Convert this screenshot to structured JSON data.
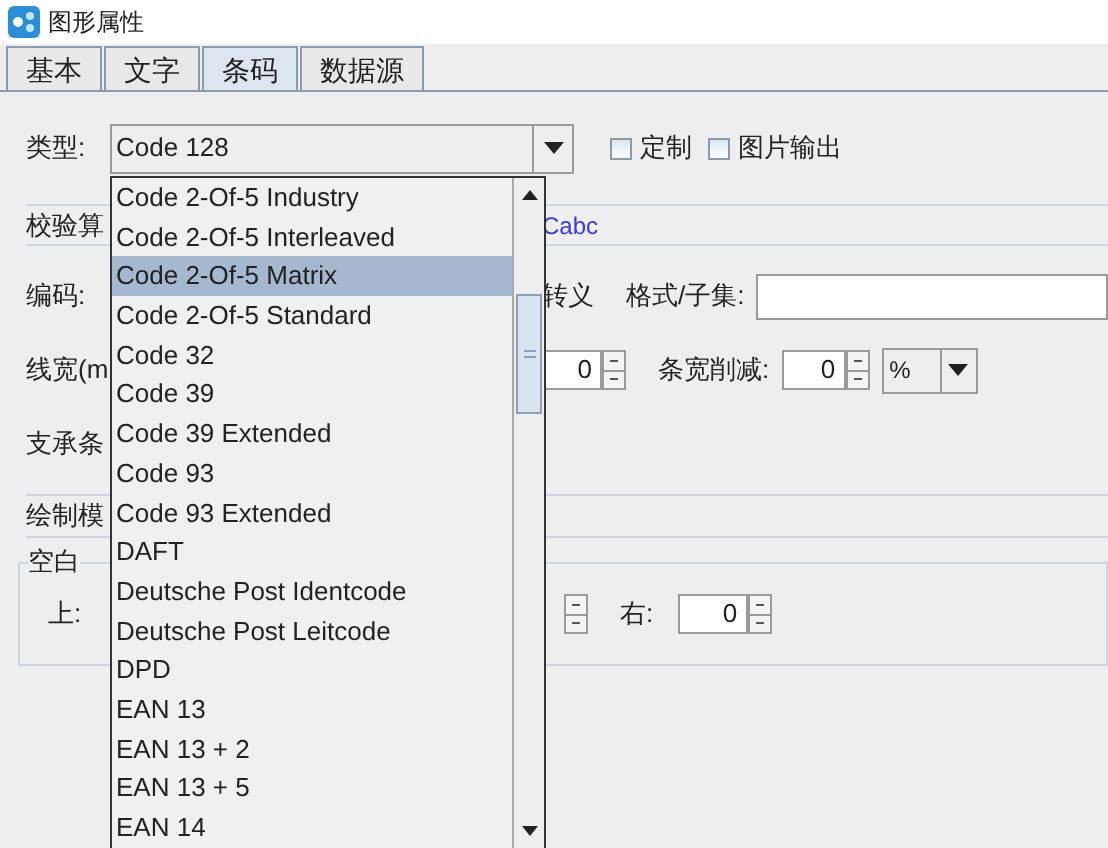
{
  "window": {
    "title": "图形属性"
  },
  "tabs": [
    {
      "label": "基本",
      "selected": false
    },
    {
      "label": "文字",
      "selected": false
    },
    {
      "label": "条码",
      "selected": true
    },
    {
      "label": "数据源",
      "selected": false
    }
  ],
  "type_row": {
    "label": "类型:",
    "value": "Code 128",
    "options": [
      {
        "label": "定制",
        "checked": false
      },
      {
        "label": "图片输出",
        "checked": false
      }
    ]
  },
  "checksum": {
    "label": "校验算",
    "value": "Cabc"
  },
  "encoding": {
    "label": "编码:",
    "escape_label": "转义",
    "format_label": "格式/子集:"
  },
  "line_width": {
    "label": "线宽(m",
    "value": "0",
    "reduction_label": "条宽削减:",
    "reduction_value": "0",
    "unit": "%"
  },
  "support_label": "支承条",
  "draw_mode_label": "绘制模",
  "quiet_zone": {
    "title": "空白",
    "top_label": "上:",
    "right_label": "右:",
    "right_value": "0"
  },
  "dropdown": {
    "items": [
      {
        "label": "Code 2-Of-5 Industry",
        "selected": false
      },
      {
        "label": "Code 2-Of-5 Interleaved",
        "selected": false
      },
      {
        "label": "Code 2-Of-5 Matrix",
        "selected": true
      },
      {
        "label": "Code 2-Of-5 Standard",
        "selected": false
      },
      {
        "label": "Code 32",
        "selected": false
      },
      {
        "label": "Code 39",
        "selected": false
      },
      {
        "label": "Code 39 Extended",
        "selected": false
      },
      {
        "label": "Code 93",
        "selected": false
      },
      {
        "label": "Code 93 Extended",
        "selected": false
      },
      {
        "label": "DAFT",
        "selected": false
      },
      {
        "label": "Deutsche Post Identcode",
        "selected": false
      },
      {
        "label": "Deutsche Post Leitcode",
        "selected": false
      },
      {
        "label": "DPD",
        "selected": false
      },
      {
        "label": "EAN 13",
        "selected": false
      },
      {
        "label": "EAN 13 + 2",
        "selected": false
      },
      {
        "label": "EAN 13 + 5",
        "selected": false
      },
      {
        "label": "EAN 14",
        "selected": false
      }
    ]
  }
}
